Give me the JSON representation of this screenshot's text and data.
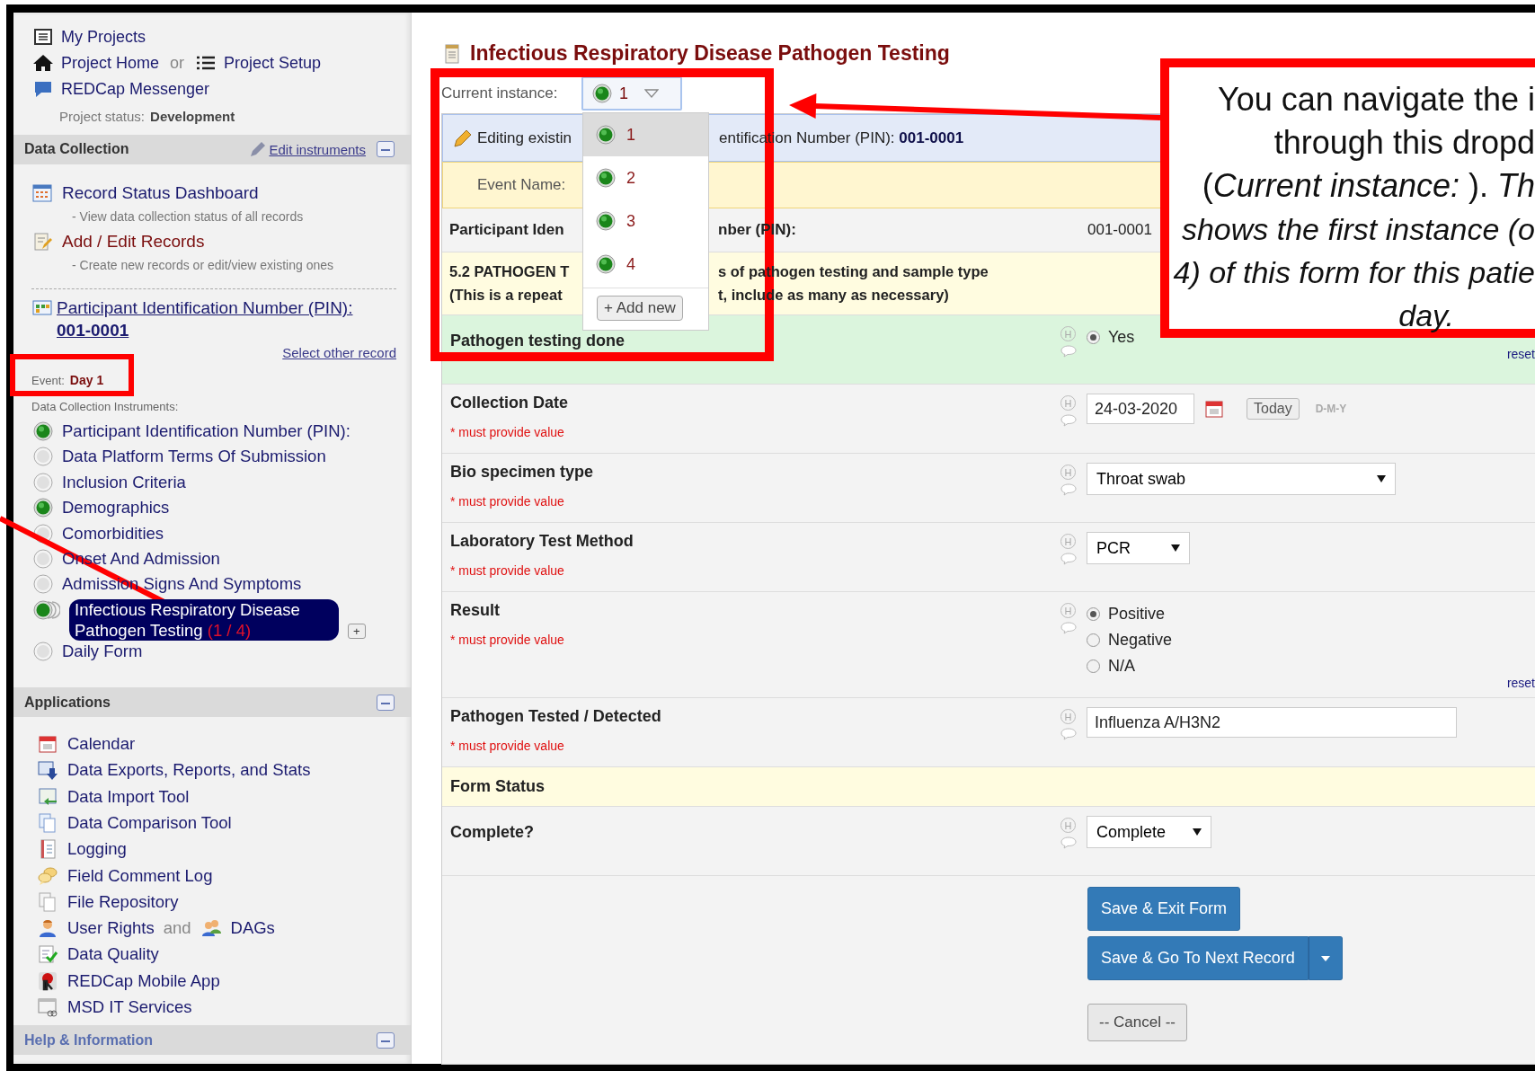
{
  "sidebar": {
    "my_projects": "My Projects",
    "project_home": "Project Home",
    "or": "or",
    "project_setup": "Project Setup",
    "messenger": "REDCap Messenger",
    "status_label": "Project status:",
    "status": "Development",
    "data_collection": {
      "title": "Data Collection",
      "edit_instruments": "Edit instruments",
      "links": [
        {
          "label": "Record Status Dashboard",
          "description": "- View data collection status of all records"
        },
        {
          "label": "Add / Edit Records",
          "description": "- Create new records or edit/view existing ones"
        }
      ],
      "record_label": "Participant Identification Number (PIN):",
      "record_id": "001-0001",
      "select_other": "Select other record",
      "event_label": "Event:",
      "event": "Day 1",
      "instruments_label": "Data Collection Instruments:",
      "instruments": [
        {
          "label": "Participant Identification Number (PIN):",
          "complete": true,
          "selected": false
        },
        {
          "label": "Data Platform Terms Of Submission",
          "complete": false,
          "selected": false
        },
        {
          "label": "Inclusion Criteria",
          "complete": false,
          "selected": false
        },
        {
          "label": "Demographics",
          "complete": true,
          "selected": false
        },
        {
          "label": "Comorbidities",
          "complete": false,
          "selected": false
        },
        {
          "label": "Onset And Admission",
          "complete": false,
          "selected": false
        },
        {
          "label": "Admission Signs And Symptoms",
          "complete": false,
          "selected": false
        },
        {
          "label": "Infectious Respiratory Disease Pathogen Testing",
          "complete": true,
          "selected": true,
          "count": "(1 / 4)",
          "add": "+"
        },
        {
          "label": "Daily Form",
          "complete": false,
          "selected": false
        }
      ]
    },
    "applications": {
      "title": "Applications",
      "items": [
        {
          "label": "Calendar"
        },
        {
          "label": "Data Exports, Reports, and Stats"
        },
        {
          "label": "Data Import Tool"
        },
        {
          "label": "Data Comparison Tool"
        },
        {
          "label": "Logging"
        },
        {
          "label": "Field Comment Log"
        },
        {
          "label": "File Repository"
        },
        {
          "label": "User Rights",
          "joiner": "and",
          "label_2": "DAGs"
        },
        {
          "label": "Data Quality"
        },
        {
          "label": "REDCap Mobile App"
        },
        {
          "label": "MSD IT Services"
        }
      ]
    },
    "help": {
      "title": "Help & Information"
    }
  },
  "form": {
    "title": "Infectious Respiratory Disease Pathogen Testing",
    "instance_label": "Current instance:",
    "current_instance": "1",
    "instance_menu": {
      "items": [
        {
          "label": "1",
          "selected": true
        },
        {
          "label": "2",
          "selected": false
        },
        {
          "label": "3",
          "selected": false
        },
        {
          "label": "4",
          "selected": false
        }
      ],
      "add_new": "+ Add new"
    },
    "editing": {
      "left": "Editing existin",
      "right": "entification Number (PIN):",
      "record": "001-0001"
    },
    "event_label": "Event Name:",
    "record_field": {
      "left": "Participant Iden",
      "right": "nber (PIN):",
      "value": "001-0001"
    },
    "section": {
      "line_1_left": "5.2 PATHOGEN T",
      "line_1_right": "s of pathogen testing and sample type",
      "line_2_left": "(This is a repeat",
      "line_2_right": "t, include as many as necessary)"
    },
    "fields": [
      {
        "kind": "radio",
        "label": "Pathogen testing done",
        "highlighted": true,
        "history": "H",
        "options": [
          {
            "label": "Yes",
            "selected": true
          }
        ],
        "reset": "reset"
      },
      {
        "kind": "date",
        "label": "Collection Date",
        "highlighted": false,
        "required": "* must provide value",
        "history": "H",
        "value": "24-03-2020",
        "today": "Today",
        "format": "D-M-Y"
      },
      {
        "kind": "select",
        "label": "Bio specimen type",
        "highlighted": false,
        "required": "* must provide value",
        "history": "H",
        "value": "Throat swab"
      },
      {
        "kind": "select",
        "label": "Laboratory Test Method",
        "highlighted": false,
        "required": "* must provide value",
        "history": "H",
        "value": "PCR"
      },
      {
        "kind": "radio",
        "label": "Result",
        "highlighted": false,
        "required": "* must provide value",
        "history": "H",
        "options": [
          {
            "label": "Positive",
            "selected": true
          },
          {
            "label": "Negative",
            "selected": false
          },
          {
            "label": "N/A",
            "selected": false
          }
        ],
        "reset": "reset"
      },
      {
        "kind": "text",
        "label": "Pathogen Tested / Detected",
        "highlighted": false,
        "required": "* must provide value",
        "history": "H",
        "value": "Influenza A/H3N2"
      },
      {
        "kind": "header",
        "label": "Form Status"
      },
      {
        "kind": "select",
        "label": "Complete?",
        "highlighted": false,
        "history": "H",
        "value": "Complete"
      }
    ],
    "buttons": {
      "save_exit": "Save & Exit Form",
      "save_next": "Save & Go To Next Record",
      "cancel": "-- Cancel --"
    }
  },
  "callout": {
    "lines": [
      {
        "text": "You can navigate the i",
        "italic": false
      },
      {
        "text": "through this dropd",
        "italic": false
      },
      {
        "text": "(*Current instance:* ). *Th*",
        "italic": false
      },
      {
        "text": "shows the first instance (o",
        "italic": true
      },
      {
        "text": "4) of this form for this patie",
        "italic": true
      },
      {
        "text": "day.",
        "italic": true
      }
    ]
  }
}
